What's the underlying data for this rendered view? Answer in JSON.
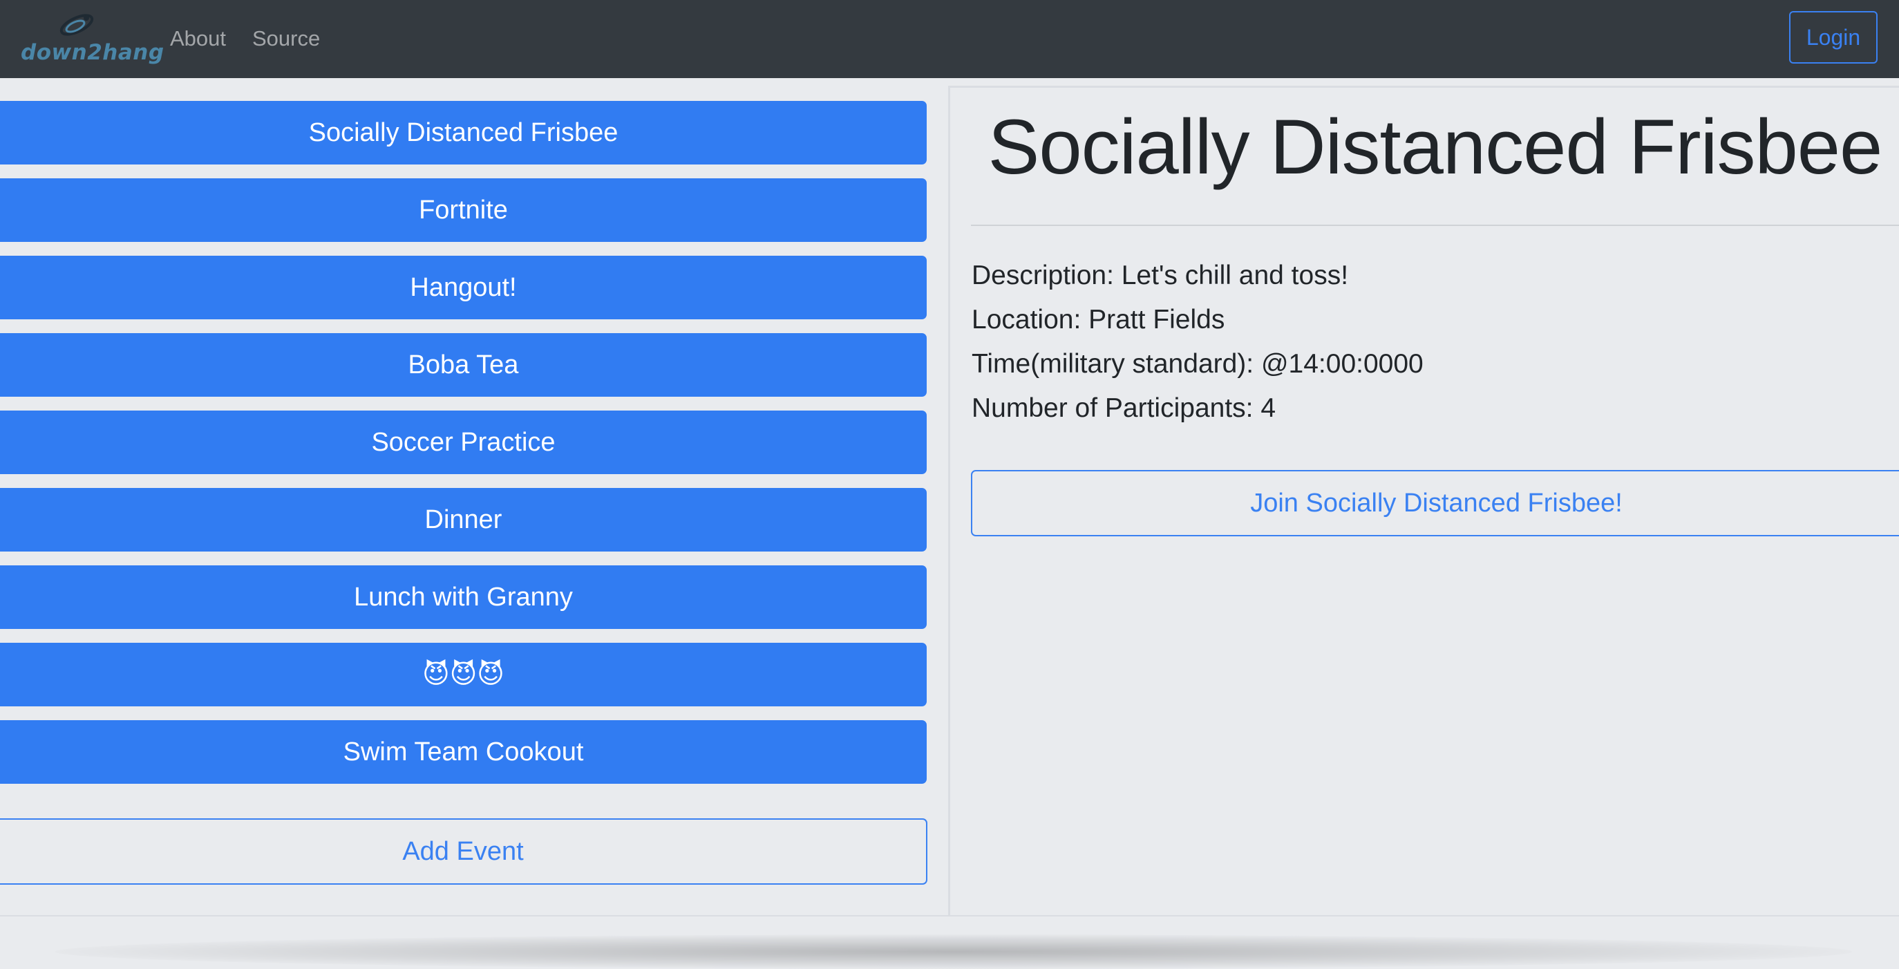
{
  "navbar": {
    "logo_text": "down2hang",
    "links": [
      "About",
      "Source"
    ],
    "login_label": "Login"
  },
  "events": [
    "Socially Distanced Frisbee",
    "Fortnite",
    "Hangout!",
    "Boba Tea",
    "Soccer Practice",
    "Dinner",
    "Lunch with Granny",
    "😈😈😈",
    "Swim Team Cookout"
  ],
  "add_event_label": "Add Event",
  "selected_event": {
    "title": "Socially Distanced Frisbee",
    "description": "Description: Let's chill and toss!",
    "location": "Location: Pratt Fields",
    "time": "Time(military standard): @14:00:0000",
    "participants": "Number of Participants: 4",
    "join_label": "Join Socially Distanced Frisbee!"
  },
  "colors": {
    "navbar_bg": "#343a40",
    "primary": "#317cf2",
    "page_bg": "#e9ebee"
  }
}
